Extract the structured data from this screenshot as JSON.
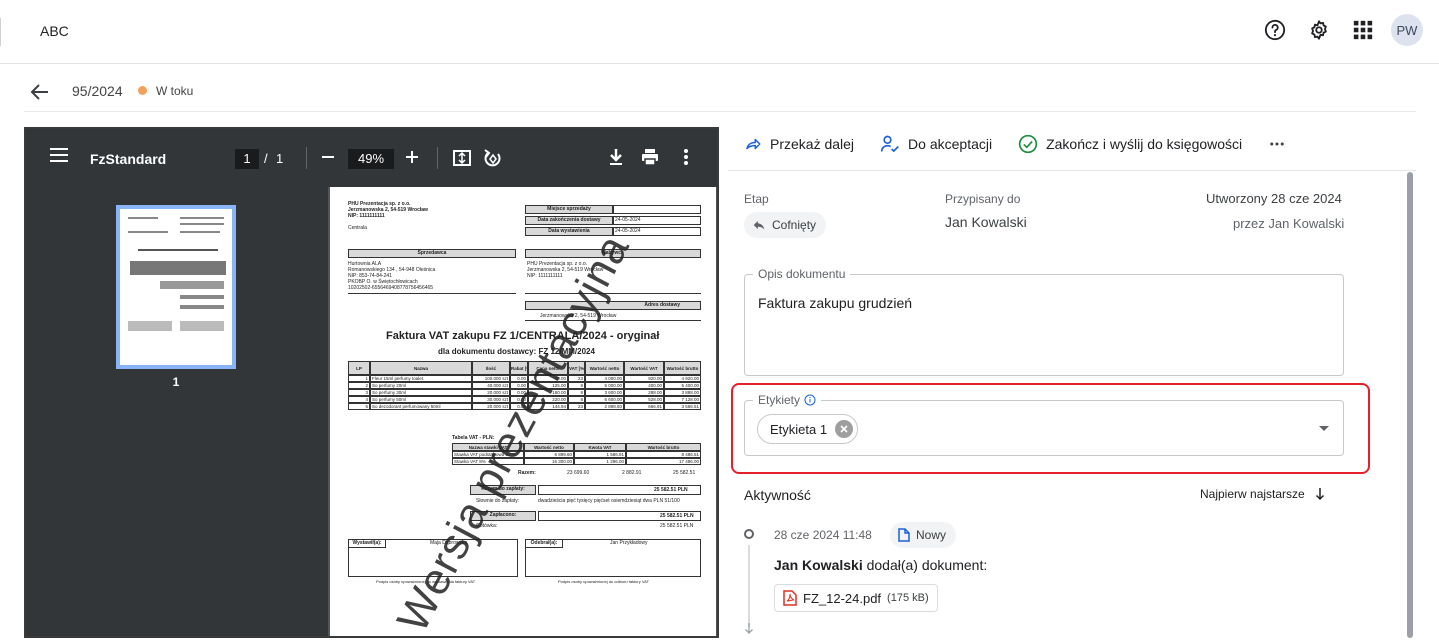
{
  "app": {
    "title": "ABC"
  },
  "topbar": {
    "help_icon": "help-circle-icon",
    "settings_icon": "gear-icon",
    "apps_icon": "grid-apps-icon",
    "avatar_initials": "PW"
  },
  "document": {
    "number": "95/2024",
    "status": "W toku",
    "status_color": "#f2a25a"
  },
  "viewer": {
    "title": "FzStandard",
    "current_page": "1",
    "page_separator": "/",
    "total_pages": "1",
    "zoom": "49%",
    "thumbnail_label": "1",
    "pdf": {
      "seller_lines": [
        "PHU Prezentacja sp. z o.o.",
        "Jerzmanowska 2, 54-519 Wrocław",
        "NIP: 1111111111"
      ],
      "centrala": "Centrala",
      "place_label": "Miejsce sprzedaży",
      "delivery_end_label": "Data zakończenia dostawy",
      "delivery_end": "24-05-2024",
      "issue_label": "Data wystawienia",
      "issue": "24-05-2024",
      "sprzedawca": "Sprzedawca",
      "nabywca": "Nabywca",
      "seller_block": [
        "Hurtownia ALA",
        "Romanowskiego 134 , 54-948 Oleśnica",
        "NIP: 853-74-84-241",
        "PKOBP O. w Świętochłowicach",
        "10202502-6556469408778756456465"
      ],
      "buyer_block": [
        "PHU Prezentacja sp. z o.o.",
        "Jerzmanowska 2, 54-519 Wrocław",
        "NIP: 1111111111"
      ],
      "adres_label": "Adres dostawy",
      "adres": "Jerzmanowska 2, 54-519 Wrocław",
      "title": "Faktura VAT zakupu FZ 1/CENTRALA/2024 - oryginał",
      "subtitle": "dla dokumentu dostawcy: FZ 12/MM/2024",
      "table_headers": [
        "LP",
        "Nazwa",
        "Ilość",
        "Rabat [%]",
        "Cena netto",
        "VAT [%]",
        "Wartość netto",
        "Wartość VAT",
        "Wartość brutto"
      ],
      "rows": [
        [
          "1",
          "Fleur 15ml perfumy toalet.",
          "100.000 szt",
          "0.00",
          "40.00",
          "23",
          "4 000.00",
          "920.00",
          "4 920.00"
        ],
        [
          "2",
          "So perfumy 20ml",
          "40.000 szt",
          "0.00",
          "125.00",
          "8",
          "5 000.00",
          "400.00",
          "5 400.00"
        ],
        [
          "3",
          "So perfumy 30ml",
          "20.000 szt",
          "0.00",
          "180.00",
          "8",
          "3 600.00",
          "288.00",
          "3 888.00"
        ],
        [
          "4",
          "So perfumy 50ml",
          "30.000 szt",
          "0.00",
          "220.00",
          "8",
          "6 600.00",
          "528.00",
          "7 128.00"
        ],
        [
          "5",
          "So dezodorant perfumowany 50ml",
          "20.000 szt",
          "0.00",
          "144.94",
          "23",
          "2 898.60",
          "666.91",
          "3 566.51"
        ]
      ],
      "vat_table_label": "Tabela VAT - PLN:",
      "vat_headers": [
        "Nazwa stawki VAT",
        "Wartość netto",
        "Kwota VAT",
        "Wartość brutto"
      ],
      "vat_rows": [
        [
          "Stawka VAT podstawowa 23 %",
          "6 899.60",
          "1 586.91",
          "8 486.51"
        ],
        [
          "Stawka VAT 8%",
          "16 300.00",
          "1 296.00",
          "17 496.00"
        ]
      ],
      "vat_total_label": "Razem:",
      "vat_total": [
        "23 699.60",
        "2 882.91",
        "25 582.51"
      ],
      "to_pay_label": "Razem do zapłaty:",
      "to_pay": "25 582.51 PLN",
      "in_words_label": "Słownie do zapłaty:",
      "in_words": "dwadzieścia pięć tysięcy pięćset osiemdziesiąt dwa PLN 51/100",
      "paid_label": "Zapłacono:",
      "paid": "25 582.51 PLN",
      "paid_words_label": "Gotówka:",
      "paid_words": "25 582.51 PLN",
      "issued_label": "Wystawił(a):",
      "issued_name": "Maja Dąbrowska",
      "received_label": "Odebrał(a):",
      "received_name": "Jan Przykładowy",
      "sig_left": "Podpis osoby upoważnionej do wystawienia faktury VAT",
      "sig_right": "Podpis osoby upoważnionej do odbioru faktury VAT",
      "watermark": "Wersja prezentacyjna"
    }
  },
  "actions": {
    "forward": "Przekaż dalej",
    "approve": "Do akceptacji",
    "finish": "Zakończ i wyślij do księgowości",
    "more": "more-horizontal-icon"
  },
  "info": {
    "stage_label": "Etap",
    "stage_value": "Cofnięty",
    "assigned_label": "Przypisany do",
    "assigned_value": "Jan Kowalski",
    "created_label": "Utworzony 28 cze 2024",
    "created_by": "przez Jan Kowalski"
  },
  "description": {
    "label": "Opis dokumentu",
    "value": "Faktura zakupu grudzień"
  },
  "tags": {
    "label": "Etykiety",
    "chips": [
      "Etykieta 1"
    ],
    "highlight_color": "#e5202a"
  },
  "activity": {
    "title": "Aktywność",
    "sort_label": "Najpierw najstarsze",
    "events": [
      {
        "date": "28 cze 2024 11:48",
        "badge": "Nowy",
        "actor": "Jan Kowalski",
        "text": " dodał(a) dokument:",
        "file": "FZ_12-24.pdf",
        "size": "(175 kB)"
      }
    ]
  }
}
